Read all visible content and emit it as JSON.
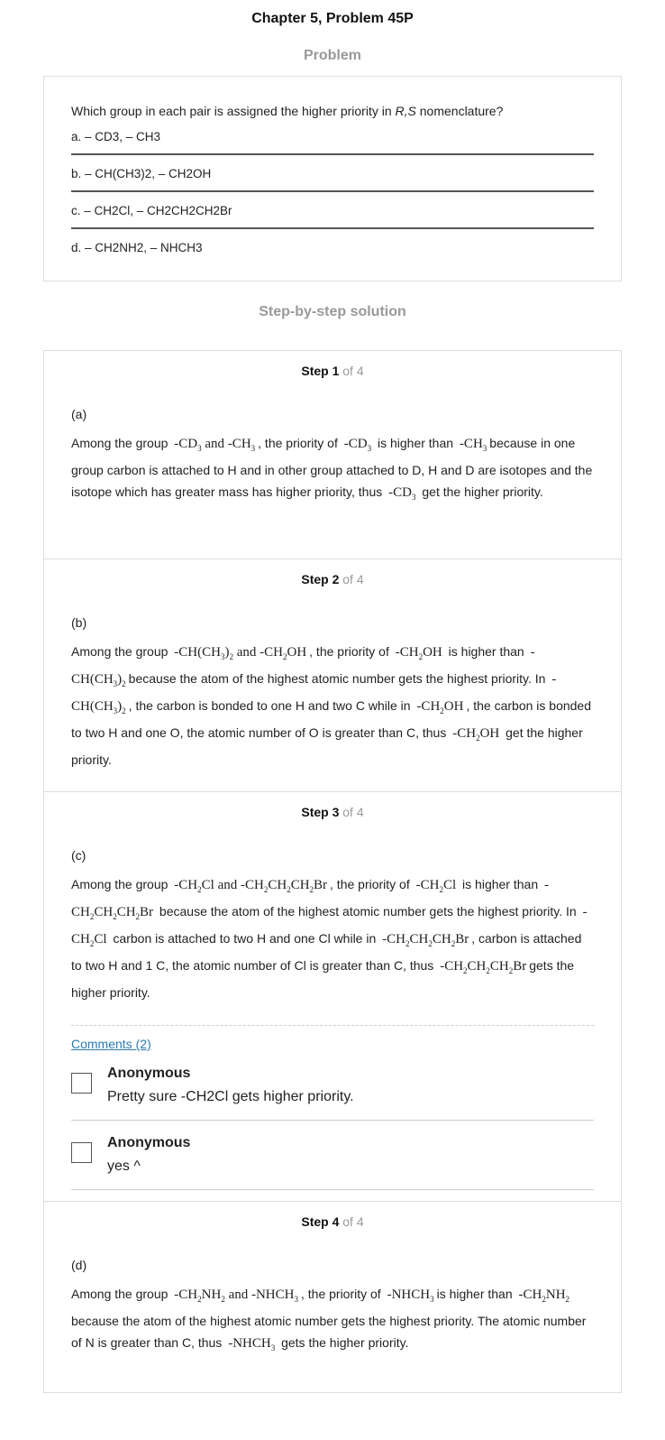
{
  "page": {
    "title": "Chapter 5, Problem 45P",
    "problem_heading": "Problem",
    "solution_heading": "Step-by-step solution"
  },
  "problem": {
    "question_prefix": "Which group in each pair is assigned the higher priority in ",
    "question_italic": "R,S",
    "question_suffix": " nomenclature?",
    "parts": [
      "a. – CD3, – CH3",
      "b. – CH(CH3)2, – CH2OH",
      "c. – CH2Cl, – CH2CH2CH2Br",
      "d. – CH2NH2, – NHCH3"
    ]
  },
  "steps": [
    {
      "label": "Step 1",
      "of": "of 4",
      "part": "(a)"
    },
    {
      "label": "Step 2",
      "of": "of 4",
      "part": "(b)"
    },
    {
      "label": "Step 3",
      "of": "of 4",
      "part": "(c)"
    },
    {
      "label": "Step 4",
      "of": "of 4",
      "part": "(d)"
    }
  ],
  "text": {
    "s1_t1": "Among the group",
    "s1_t2": ", the priority of",
    "s1_t3": "is higher than",
    "s1_t4": "because in one group carbon is attached to H and in other group attached to D, H and D are isotopes and the isotope which has greater mass has higher priority, thus",
    "s1_t5": "get the higher priority.",
    "s2_t1": "Among the group",
    "s2_t2": ", the priority of",
    "s2_t3": "is higher than",
    "s2_t4": "because the atom of the highest atomic number gets the highest priority. In",
    "s2_t5": ", the carbon is bonded to one H and two C while in",
    "s2_t6": ", the carbon is bonded to two H and one O, the atomic number of O is greater than C, thus",
    "s2_t7": "get the higher priority.",
    "s3_t1": "Among the group",
    "s3_t2": ", the priority of",
    "s3_t3": "is higher than",
    "s3_t4": "because the atom of the highest atomic number gets the highest priority. In",
    "s3_t5": "carbon is attached to two H and one Cl while in",
    "s3_t6": ", carbon is attached to two H and 1 C, the atomic number of Cl is greater than C, thus",
    "s3_t7": "gets the higher priority.",
    "s4_t1": "Among the group",
    "s4_t2": ", the priority of",
    "s4_t3": "is higher than",
    "s4_t4": "because the atom of the highest atomic number gets the highest priority. The atomic number of N is greater than C, thus",
    "s4_t5": "gets the higher priority.",
    "and": "and",
    "cd": "-CD",
    "ch": "-CH",
    "ch_paren": "-CH(CH",
    "ch2oh_pre": "-CH",
    "oh": "OH",
    "cl": "Cl",
    "ch2ch2ch2": "-CH",
    "ch_mid": "CH",
    "br": "Br",
    "nh": "NH",
    "nhch": "-NHCH",
    "sub2": "2",
    "sub3": "3",
    "paren_close": ")"
  },
  "comments": {
    "link_label": "Comments (2)",
    "items": [
      {
        "author": "Anonymous",
        "text": "Pretty sure -CH2Cl gets higher priority."
      },
      {
        "author": "Anonymous",
        "text": "yes ^"
      }
    ]
  }
}
